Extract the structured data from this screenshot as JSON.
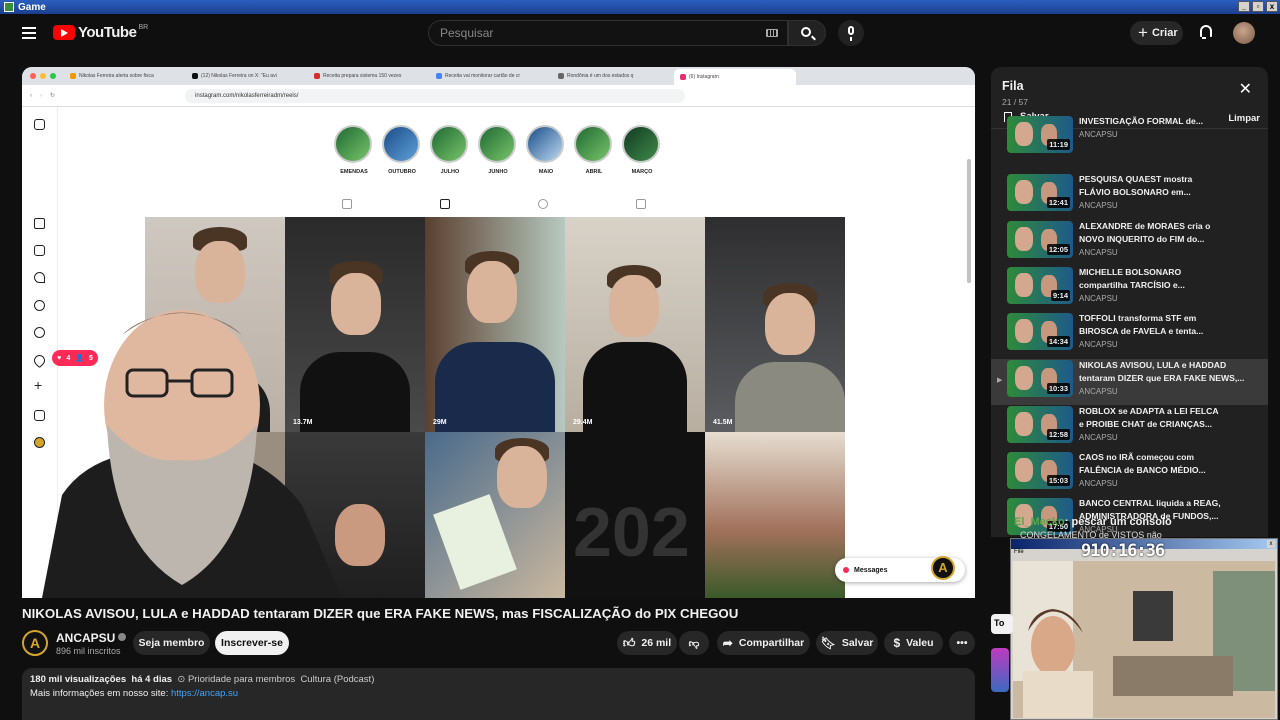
{
  "window": {
    "title": "Game"
  },
  "header": {
    "logo_text": "YouTube",
    "country": "BR",
    "search_placeholder": "Pesquisar",
    "create_label": "Criar"
  },
  "browser": {
    "tabs": [
      {
        "label": "Nikolas Ferreira alerta sobre fisca",
        "color": "#f29900"
      },
      {
        "label": "(12) Nikolas Ferreira on X: \"Eu avi",
        "color": "#111111"
      },
      {
        "label": "Receita prepara sistema 150 vezes",
        "color": "#d62d2d"
      },
      {
        "label": "Receita vai monitorar cartão de cr",
        "color": "#4285f4"
      },
      {
        "label": "Rondônia é um dos estados q",
        "color": "#666666"
      },
      {
        "label": "(6) Instagram",
        "color": "#e1306c"
      }
    ],
    "url": "instagram.com/nikolasferreiradm/reels/"
  },
  "instagram": {
    "highlights": [
      "EMENDAS",
      "OUTUBRO",
      "JULHO",
      "JUNHO",
      "MAIO",
      "ABRIL",
      "MARÇO"
    ],
    "reels": [
      {
        "views": ""
      },
      {
        "views": "13.7M"
      },
      {
        "views": "29M"
      },
      {
        "views": "29.4M"
      },
      {
        "views": "41.5M"
      },
      {
        "views": ""
      },
      {
        "views": ""
      },
      {
        "views": ""
      },
      {
        "views": ""
      },
      {
        "views": ""
      }
    ],
    "messages_label": "Messages",
    "notif_hearts": "4",
    "notif_follows": "5"
  },
  "video": {
    "title": "NIKOLAS AVISOU, LULA e HADDAD tentaram DIZER que ERA FAKE NEWS, mas FISCALIZAÇÃO do PIX CHEGOU",
    "channel": "ANCAPSU",
    "subscribers": "896 mil inscritos",
    "join_label": "Seja membro",
    "subscribe_label": "Inscrever-se",
    "likes": "26 mil",
    "share_label": "Compartilhar",
    "save_label": "Salvar",
    "thanks_label": "Valeu",
    "views": "180 mil visualizações",
    "age": "há 4 dias",
    "priority": "Prioridade para membros",
    "category": "Cultura (Podcast)",
    "more_info": "Mais informações em nosso site:",
    "link": "https://ancap.su"
  },
  "queue": {
    "title": "Fila",
    "position": "21 / 57",
    "save_label": "Salvar",
    "clear_label": "Limpar",
    "items": [
      {
        "title": "INVESTIGAÇÃO FORMAL de...",
        "title2": "",
        "channel": "ANCAPSU",
        "duration": "11:19"
      },
      {
        "title": "PESQUISA QUAEST mostra",
        "title2": "FLÁVIO BOLSONARO em...",
        "channel": "ANCAPSU",
        "duration": "12:41"
      },
      {
        "title": "ALEXANDRE de MORAES cria o",
        "title2": "NOVO INQUERITO do FIM do...",
        "channel": "ANCAPSU",
        "duration": "12:05"
      },
      {
        "title": "MICHELLE BOLSONARO",
        "title2": "compartilha TARCÍSIO e...",
        "channel": "ANCAPSU",
        "duration": "9:14"
      },
      {
        "title": "TOFFOLI transforma STF em",
        "title2": "BIROSCA de FAVELA e tenta...",
        "channel": "ANCAPSU",
        "duration": "14:34"
      },
      {
        "title": "NIKOLAS AVISOU, LULA e HADDAD",
        "title2": "tentaram DIZER que ERA FAKE NEWS,...",
        "channel": "ANCAPSU",
        "duration": "10:33"
      },
      {
        "title": "ROBLOX se ADAPTA a LEI FELCA",
        "title2": "e PROIBE CHAT de CRIANÇAS...",
        "channel": "ANCAPSU",
        "duration": "12:58"
      },
      {
        "title": "CAOS no IRÃ começou com",
        "title2": "FALÊNCIA de BANCO MÉDIO...",
        "channel": "ANCAPSU",
        "duration": "15:03"
      },
      {
        "title": "BANCO CENTRAL liquida a REAG,",
        "title2": "ADMINISTRADORA de FUNDOS,...",
        "channel": "ANCAPSU",
        "duration": "17:50"
      }
    ]
  },
  "overlay": {
    "chat_name": "El_Mecko",
    "chat_msg": ": pescar um consolo",
    "chat_line2": "CONGELAMENTO de VISTOS não",
    "timer": "910:16:36",
    "peek_label": "To"
  },
  "colors": {
    "brand_red": "#ff0000",
    "accent_link": "#3ea6ff",
    "instagram_badge": "#ff2a55",
    "ancap_gold": "#d4a52b"
  }
}
